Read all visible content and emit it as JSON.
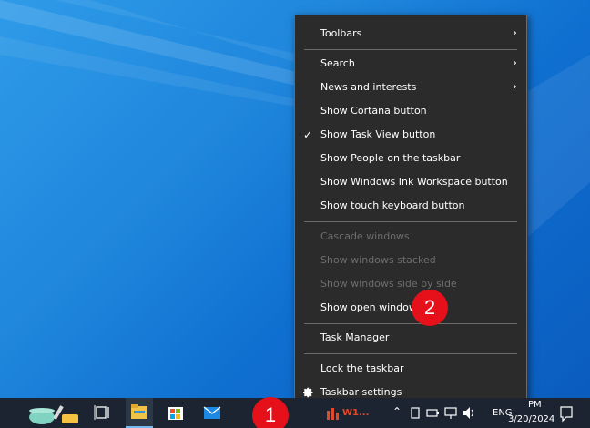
{
  "context_menu": {
    "items": [
      {
        "label": "Toolbars",
        "submenu": true
      },
      {
        "label": "Search",
        "submenu": true
      },
      {
        "label": "News and interests",
        "submenu": true
      },
      {
        "label": "Show Cortana button"
      },
      {
        "label": "Show Task View button",
        "checked": true
      },
      {
        "label": "Show People on the taskbar"
      },
      {
        "label": "Show Windows Ink Workspace button"
      },
      {
        "label": "Show touch keyboard button"
      },
      {
        "label": "Cascade windows",
        "disabled": true
      },
      {
        "label": "Show windows stacked",
        "disabled": true
      },
      {
        "label": "Show windows side by side",
        "disabled": true
      },
      {
        "label": "Show open windows"
      },
      {
        "label": "Task Manager"
      },
      {
        "label": "Lock the taskbar"
      },
      {
        "label": "Taskbar settings",
        "icon": "gear-icon"
      }
    ],
    "submenu_glyph": "›",
    "check_glyph": "✓"
  },
  "callouts": {
    "one": "1",
    "two": "2"
  },
  "taskbar": {
    "running_app_label": "W1...",
    "language": "ENG",
    "time": "PM",
    "date": "3/20/2024",
    "icons": [
      "desktop-app-icon",
      "task-view-icon",
      "file-explorer-icon",
      "microsoft-store-icon",
      "mail-icon",
      "running-app-icon",
      "show-hidden-icons-chevron",
      "tablet-icon",
      "battery-icon",
      "network-icon",
      "volume-icon",
      "action-center-icon"
    ]
  },
  "colors": {
    "menu_bg": "#2b2b2b",
    "menu_text": "#ffffff",
    "menu_disabled": "#6d6d6d",
    "callout": "#e5101a",
    "taskbar_bg": "#1b2430"
  }
}
